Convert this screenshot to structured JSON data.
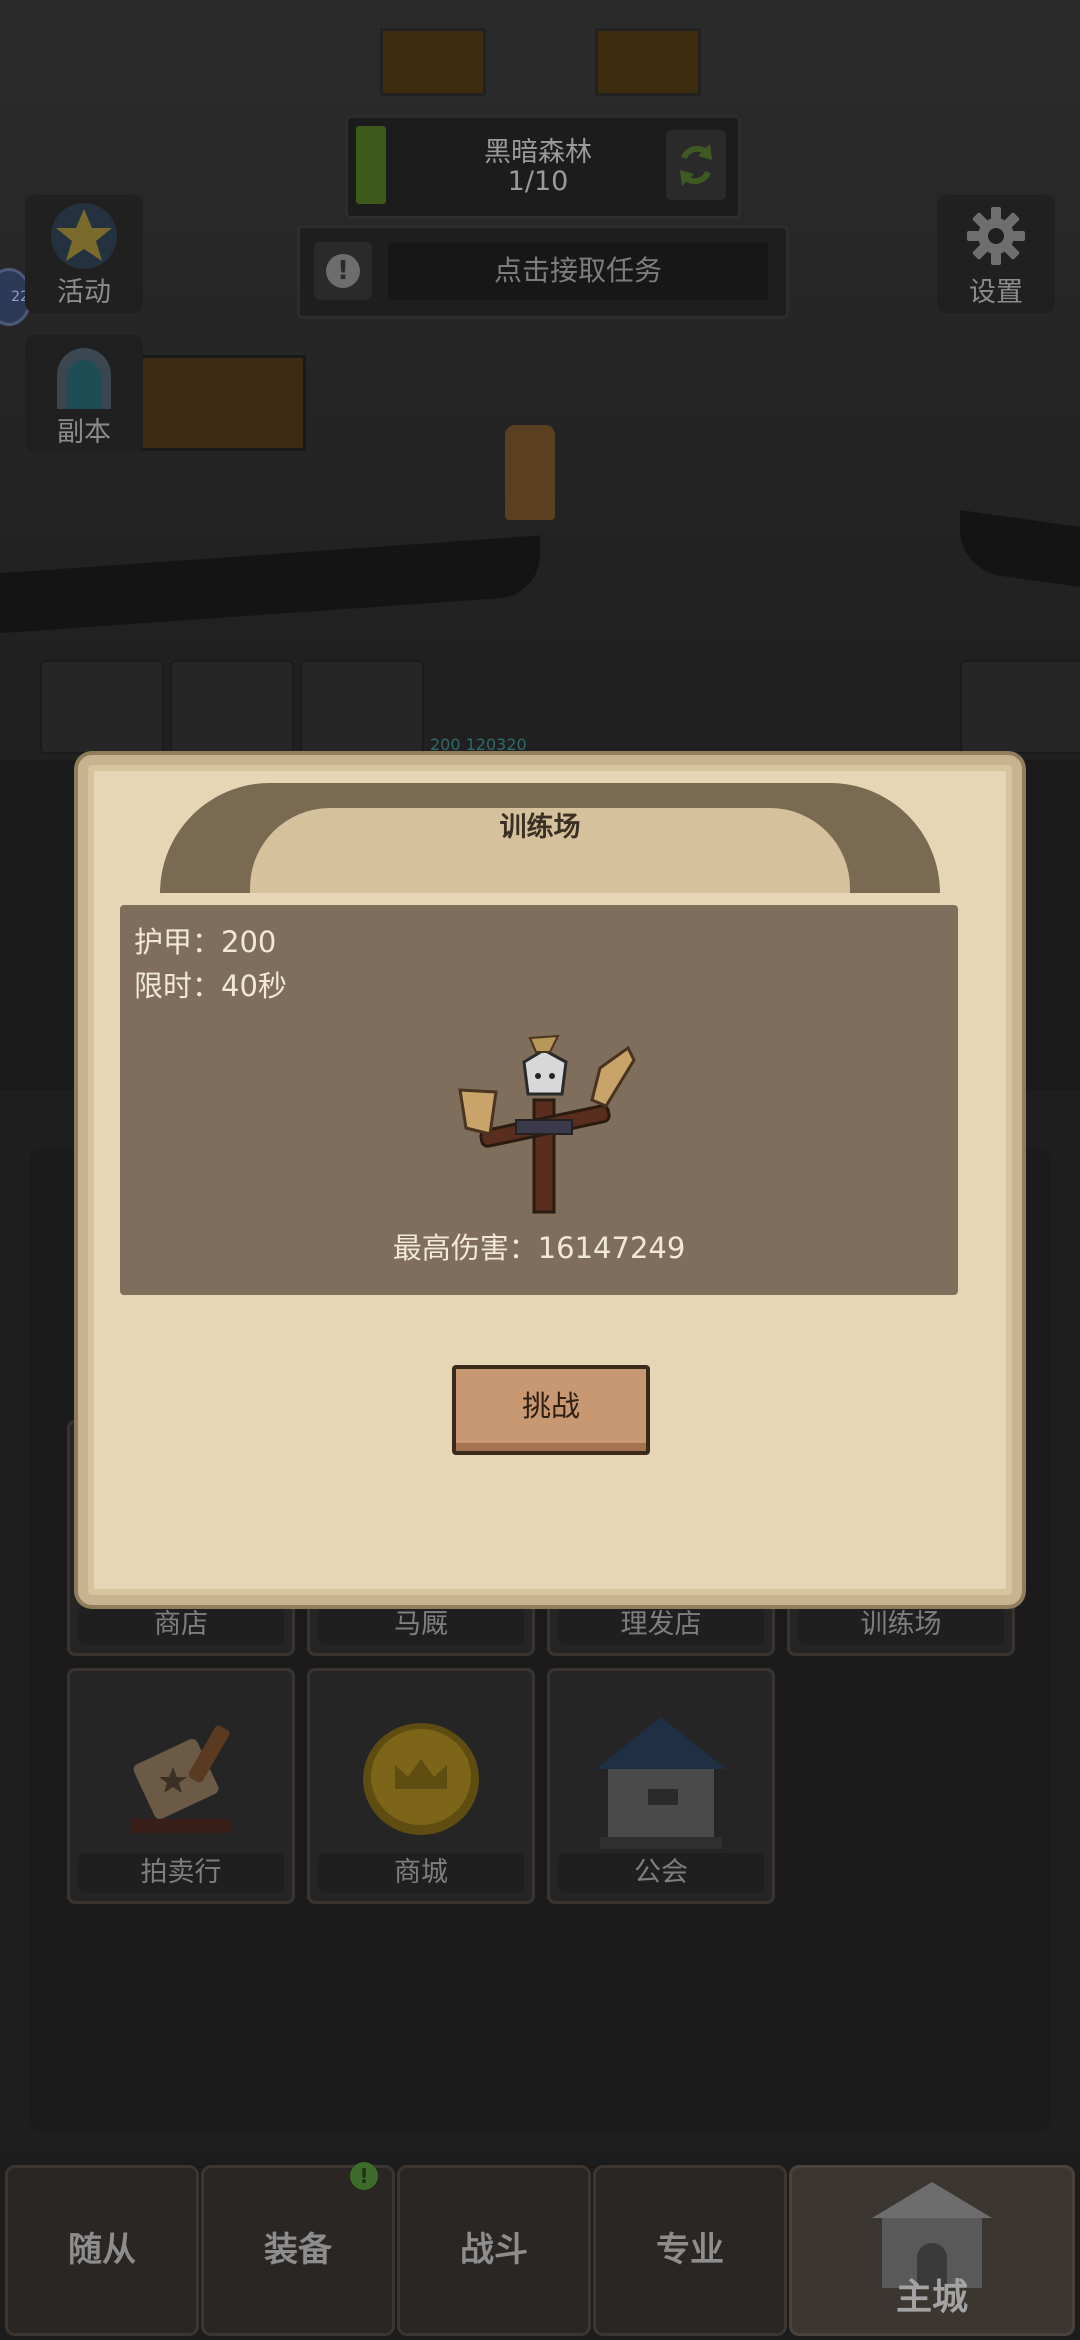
{
  "hud": {
    "zone_name": "黑暗森林",
    "zone_progress": "1/10",
    "quest_text": "点击接取任务",
    "settings_label": "设置",
    "level_badge": "22"
  },
  "side_buttons": [
    {
      "label": "活动",
      "icon": "star-icon"
    },
    {
      "label": "副本",
      "icon": "dungeon-portal-icon"
    }
  ],
  "buildings": [
    {
      "label": "商店"
    },
    {
      "label": "马厩"
    },
    {
      "label": "理发店"
    },
    {
      "label": "训练场"
    },
    {
      "label": "拍卖行",
      "icon": "auction-gavel-icon"
    },
    {
      "label": "商城",
      "icon": "gold-coin-icon"
    },
    {
      "label": "公会",
      "icon": "guild-house-icon"
    }
  ],
  "scene": {
    "floating_text": "200 120320"
  },
  "modal": {
    "title": "训练场",
    "armor": "护甲：200",
    "time_limit": "限时：40秒",
    "best_damage": "最高伤害：16147249",
    "challenge_label": "挑战",
    "target_icon": "training-dummy-icon"
  },
  "bottom_nav": [
    {
      "label": "随从"
    },
    {
      "label": "装备",
      "badge": "!"
    },
    {
      "label": "战斗"
    },
    {
      "label": "专业"
    },
    {
      "label": "主城",
      "active": true
    }
  ],
  "colors": {
    "modal_bg": "#e6d6b6",
    "panel_bg": "#7f6e5b",
    "button_bg": "#c89872",
    "overlay_bg": "#1a1a1a"
  }
}
